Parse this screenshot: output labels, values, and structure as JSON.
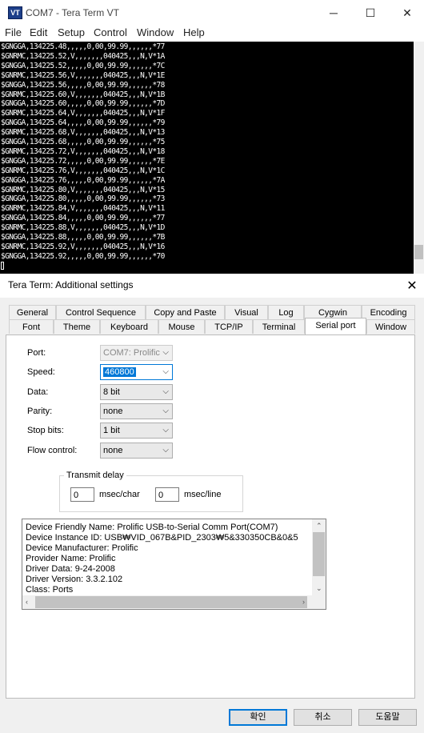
{
  "window": {
    "title": "COM7 - Tera Term VT",
    "app_icon_text": "VT",
    "minimize_glyph": "─",
    "maximize_glyph": "☐",
    "close_glyph": "✕"
  },
  "menu": [
    "File",
    "Edit",
    "Setup",
    "Control",
    "Window",
    "Help"
  ],
  "terminal": {
    "lines": [
      "$GNGGA,134225.48,,,,,0,00,99.99,,,,,,*77",
      "$GNRMC,134225.52,V,,,,,,,040425,,,N,V*1A",
      "$GNGGA,134225.52,,,,,0,00,99.99,,,,,,*7C",
      "$GNRMC,134225.56,V,,,,,,,040425,,,N,V*1E",
      "$GNGGA,134225.56,,,,,0,00,99.99,,,,,,*78",
      "$GNRMC,134225.60,V,,,,,,,040425,,,N,V*1B",
      "$GNGGA,134225.60,,,,,0,00,99.99,,,,,,*7D",
      "$GNRMC,134225.64,V,,,,,,,040425,,,N,V*1F",
      "$GNGGA,134225.64,,,,,0,00,99.99,,,,,,*79",
      "$GNRMC,134225.68,V,,,,,,,040425,,,N,V*13",
      "$GNGGA,134225.68,,,,,0,00,99.99,,,,,,*75",
      "$GNRMC,134225.72,V,,,,,,,040425,,,N,V*18",
      "$GNGGA,134225.72,,,,,0,00,99.99,,,,,,*7E",
      "$GNRMC,134225.76,V,,,,,,,040425,,,N,V*1C",
      "$GNGGA,134225.76,,,,,0,00,99.99,,,,,,*7A",
      "$GNRMC,134225.80,V,,,,,,,040425,,,N,V*15",
      "$GNGGA,134225.80,,,,,0,00,99.99,,,,,,*73",
      "$GNRMC,134225.84,V,,,,,,,040425,,,N,V*11",
      "$GNGGA,134225.84,,,,,0,00,99.99,,,,,,*77",
      "$GNRMC,134225.88,V,,,,,,,040425,,,N,V*1D",
      "$GNGGA,134225.88,,,,,0,00,99.99,,,,,,*7B",
      "$GNRMC,134225.92,V,,,,,,,040425,,,N,V*16",
      "$GNGGA,134225.92,,,,,0,00,99.99,,,,,,*70"
    ]
  },
  "dialog": {
    "title": "Tera Term: Additional settings",
    "close_glyph": "✕",
    "tabs_row1": [
      "General",
      "Control Sequence",
      "Copy and Paste",
      "Visual",
      "Log",
      "Cygwin",
      "Encoding"
    ],
    "tabs_row2": [
      "Font",
      "Theme",
      "Keyboard",
      "Mouse",
      "TCP/IP",
      "Terminal",
      "Serial port",
      "Window"
    ],
    "active_tab": "Serial port",
    "fields": {
      "port": {
        "label": "Port:",
        "value": "COM7: Prolific"
      },
      "speed": {
        "label": "Speed:",
        "value": "460800"
      },
      "data": {
        "label": "Data:",
        "value": "8 bit"
      },
      "parity": {
        "label": "Parity:",
        "value": "none"
      },
      "stop_bits": {
        "label": "Stop bits:",
        "value": "1 bit"
      },
      "flow_control": {
        "label": "Flow control:",
        "value": "none"
      }
    },
    "transmit_delay": {
      "legend": "Transmit delay",
      "char_value": "0",
      "char_unit": "msec/char",
      "line_value": "0",
      "line_unit": "msec/line"
    },
    "device_info": [
      "Device Friendly Name: Prolific USB-to-Serial Comm Port(COM7)",
      "Device Instance ID: USB₩VID_067B&PID_2303₩5&330350CB&0&5",
      "Device Manufacturer: Prolific",
      "Provider Name: Prolific",
      "Driver Data: 9-24-2008",
      "Driver Version: 3.3.2.102",
      "Class: Ports"
    ],
    "buttons": {
      "ok": "확인",
      "cancel": "취소",
      "help": "도움말"
    }
  }
}
